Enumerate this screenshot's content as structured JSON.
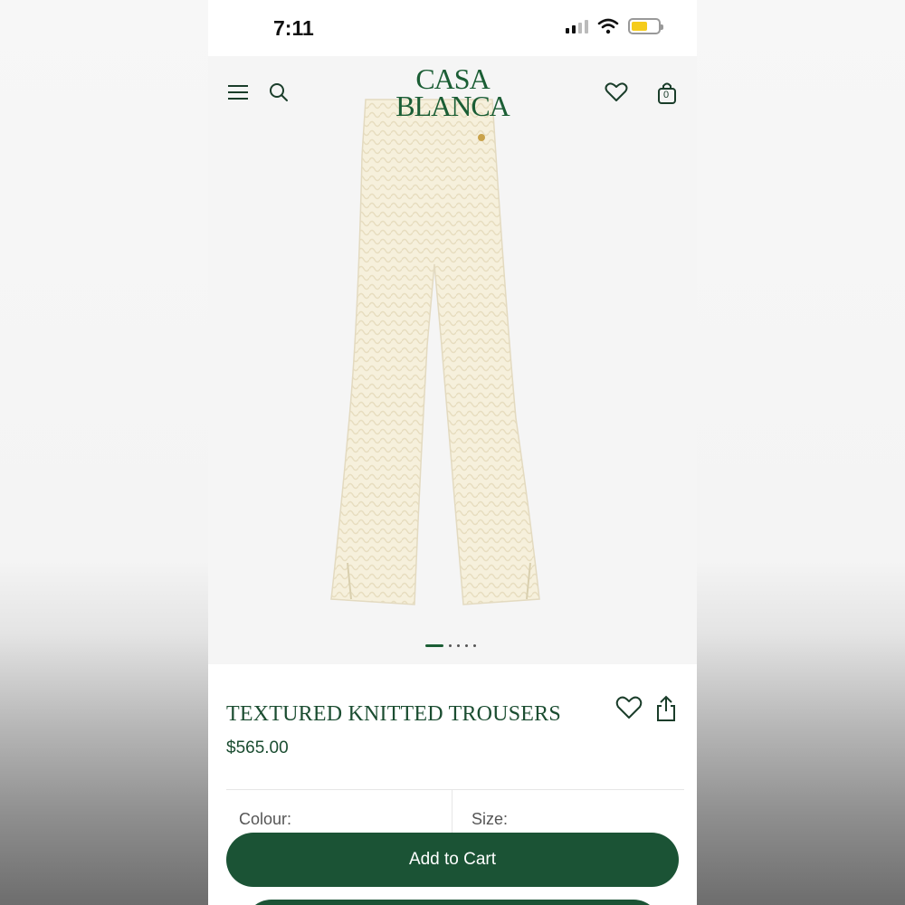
{
  "status_bar": {
    "time": "7:11",
    "battery_level": 0.6
  },
  "header": {
    "logo_line1": "CASA",
    "logo_line2": "BLANCA",
    "menu_icon": "hamburger-icon",
    "search_icon": "search-icon",
    "wishlist_icon": "heart-icon",
    "bag_icon": "shopping-bag-icon",
    "bag_count": "0"
  },
  "gallery": {
    "total_images": 5,
    "current_index": 1
  },
  "product": {
    "title": "TEXTURED KNITTED TROUSERS",
    "price": "$565.00",
    "wishlist_icon": "heart-outline-icon",
    "share_icon": "share-icon"
  },
  "options": {
    "colour_label": "Colour:",
    "size_label": "Size:"
  },
  "actions": {
    "add_to_cart": "Add to Cart"
  },
  "colors": {
    "brand_green": "#1b5335",
    "cream": "#f6f0dc",
    "battery": "#f5cc1b"
  }
}
